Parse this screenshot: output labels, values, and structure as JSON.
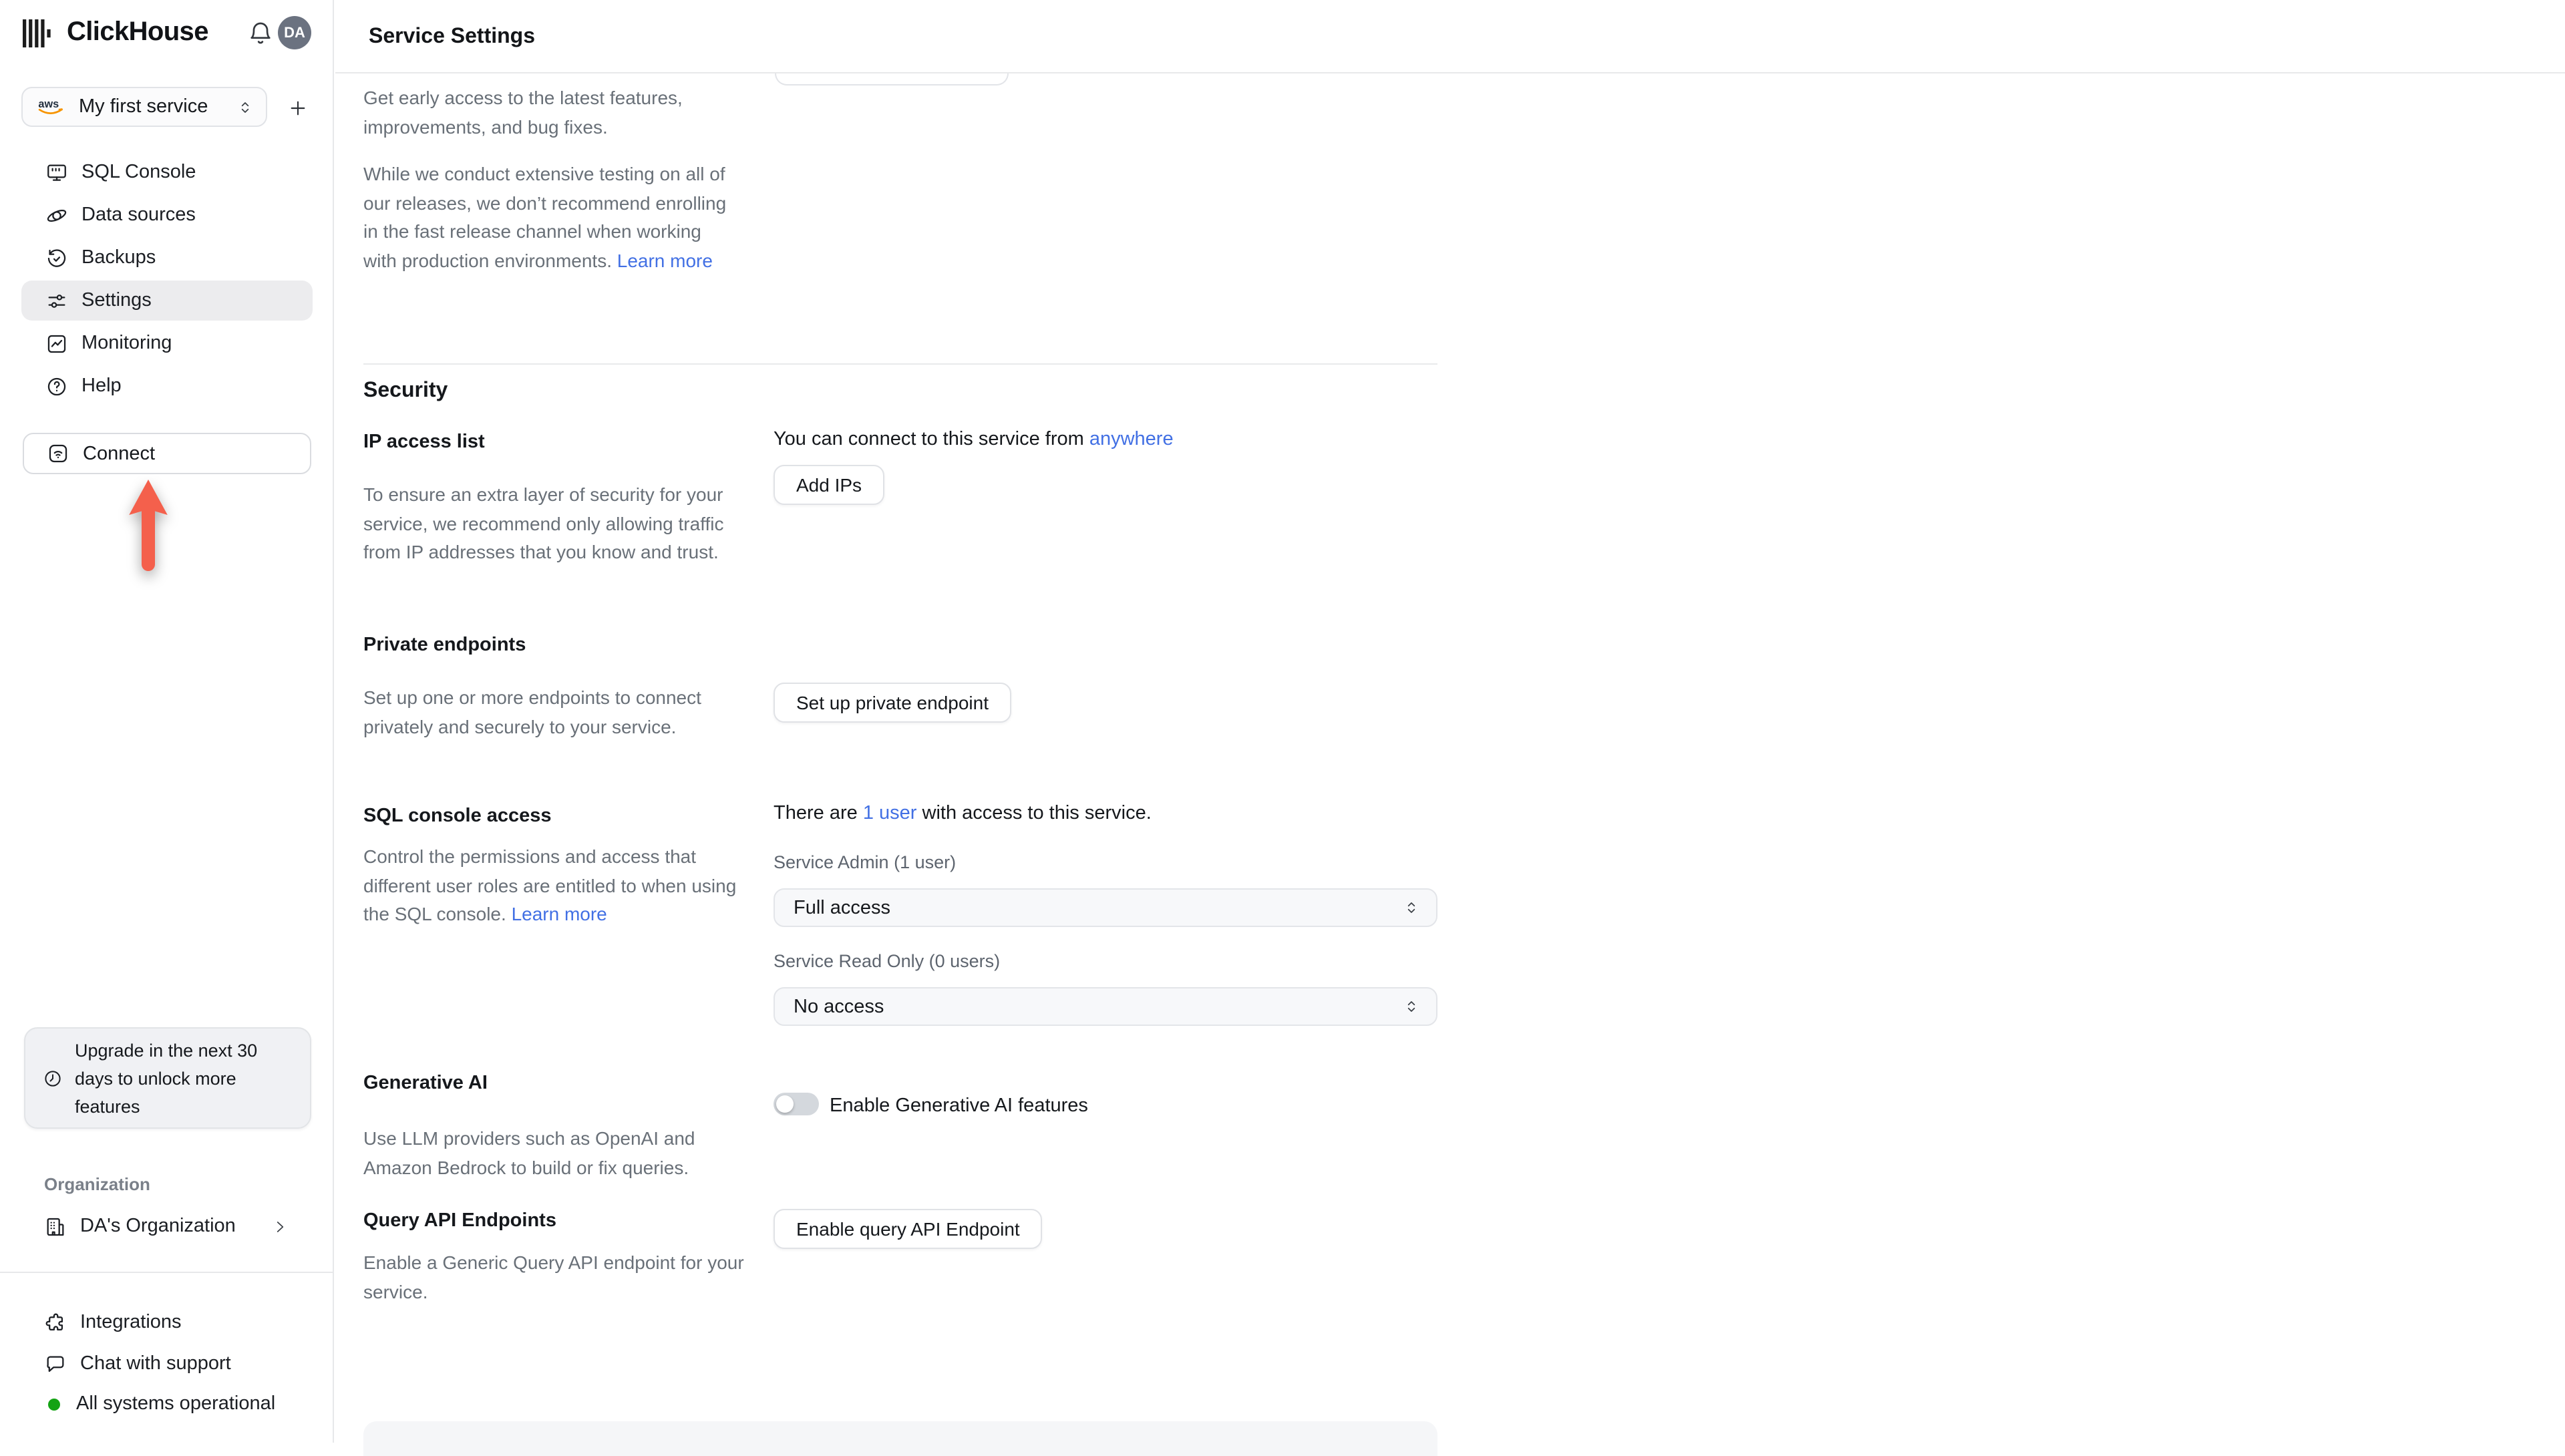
{
  "topbar": {
    "brand": "ClickHouse",
    "avatar": "DA"
  },
  "sidebar": {
    "service_selector": {
      "provider": "aws",
      "name": "My first service"
    },
    "nav": [
      {
        "label": "SQL Console"
      },
      {
        "label": "Data sources"
      },
      {
        "label": "Backups"
      },
      {
        "label": "Settings"
      },
      {
        "label": "Monitoring"
      },
      {
        "label": "Help"
      }
    ],
    "connect_label": "Connect",
    "upgrade_notice": "Upgrade in the next 30 days to unlock more features",
    "organization": {
      "section_label": "Organization",
      "name": "DA's Organization"
    },
    "footer": {
      "integrations": "Integrations",
      "chat": "Chat with support",
      "status": "All systems operational"
    }
  },
  "main": {
    "title": "Service Settings",
    "release_channel": {
      "p1": "Get early access to the latest features, improvements, and bug fixes.",
      "p2": "While we conduct extensive testing on all of our releases, we don’t recommend enrolling in the fast release channel when working with production environments. ",
      "p2_link": "Learn more"
    },
    "security": {
      "heading": "Security",
      "ip_access": {
        "title": "IP access list",
        "line_prefix": "You can connect to this service from ",
        "line_link": "anywhere",
        "button": "Add IPs",
        "desc": "To ensure an extra layer of security for your service, we recommend only allowing traffic from IP addresses that you know and trust."
      },
      "private_endpoints": {
        "title": "Private endpoints",
        "desc": "Set up one or more endpoints to connect privately and securely to your service.",
        "button": "Set up private endpoint"
      },
      "sql_console_access": {
        "title": "SQL console access",
        "desc": "Control the permissions and access that different user roles are entitled to when using the SQL console. ",
        "desc_link": "Learn more",
        "line_prefix": "There are ",
        "line_link": "1 user",
        "line_suffix": " with access to this service.",
        "admin_label": "Service Admin (1 user)",
        "admin_value": "Full access",
        "readonly_label": "Service Read Only (0 users)",
        "readonly_value": "No access"
      },
      "generative_ai": {
        "title": "Generative AI",
        "desc": "Use LLM providers such as OpenAI and Amazon Bedrock to build or fix queries.",
        "toggle_label": "Enable Generative AI features"
      },
      "query_api": {
        "title": "Query API Endpoints",
        "desc": "Enable a Generic Query API endpoint for your service.",
        "button": "Enable query API Endpoint"
      }
    }
  },
  "colors": {
    "accent_link": "#4270e4",
    "arrow_red": "#f4604c",
    "status_green": "#14a314",
    "avatar_bg": "#6b7280",
    "aws_orange": "#f79400"
  }
}
